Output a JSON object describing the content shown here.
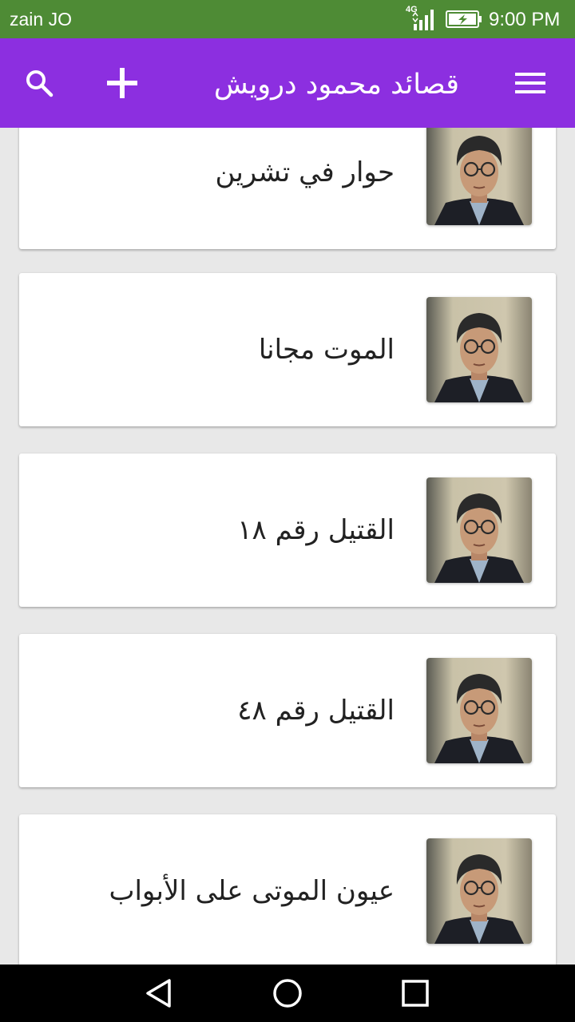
{
  "status_bar": {
    "carrier": "zain JO",
    "network": "4G",
    "time": "9:00 PM",
    "icons": [
      "signal-icon",
      "battery-charging-icon"
    ]
  },
  "app_bar": {
    "title": "قصائد محمود درويش",
    "icons": [
      "menu-icon",
      "add-icon",
      "search-icon"
    ]
  },
  "colors": {
    "status_bar": "#4e8b35",
    "app_bar": "#8c2fe0",
    "background": "#e8e8e8",
    "card": "#ffffff",
    "title_text": "#222222"
  },
  "poems": [
    {
      "title": "حوار في تشرين"
    },
    {
      "title": "الموت مجانا"
    },
    {
      "title": "القتيل رقم ١٨"
    },
    {
      "title": "القتيل رقم ٤٨"
    },
    {
      "title": "عيون الموتى على الأبواب"
    }
  ],
  "nav_bar": {
    "icons": [
      "back-icon",
      "home-icon",
      "recent-apps-icon"
    ]
  }
}
